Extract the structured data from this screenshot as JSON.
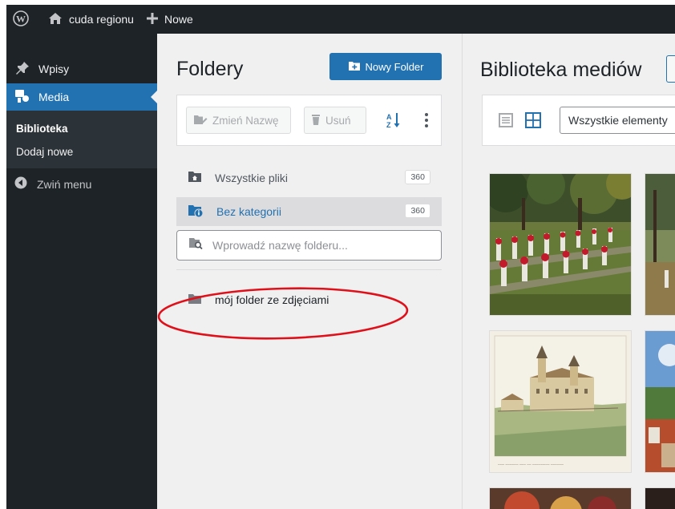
{
  "adminbar": {
    "site_name": "cuda regionu",
    "new_label": "Nowe",
    "icons": [
      "wordpress-logo-icon",
      "home-icon",
      "plus-icon"
    ]
  },
  "menu": {
    "posts_label": "Wpisy",
    "media_label": "Media",
    "submenu": {
      "library_label": "Biblioteka",
      "add_new_label": "Dodaj nowe"
    },
    "collapse_label": "Zwiń menu"
  },
  "folders": {
    "title": "Foldery",
    "new_folder_label": "Nowy Folder",
    "rename_label": "Zmień Nazwę",
    "delete_label": "Usuń",
    "items": [
      {
        "label": "Wszystkie pliki",
        "count": "360"
      },
      {
        "label": "Bez kategorii",
        "count": "360"
      }
    ],
    "search_placeholder": "Wprowadź nazwę folderu...",
    "user_folders": [
      {
        "label": "mój folder ze zdjęciami"
      }
    ]
  },
  "library": {
    "title": "Biblioteka mediów",
    "filter_label": "Wszystkie elementy"
  },
  "colors": {
    "admin_dark": "#1d2327",
    "accent_blue": "#2271b1",
    "annotation_red": "#e0101a"
  }
}
